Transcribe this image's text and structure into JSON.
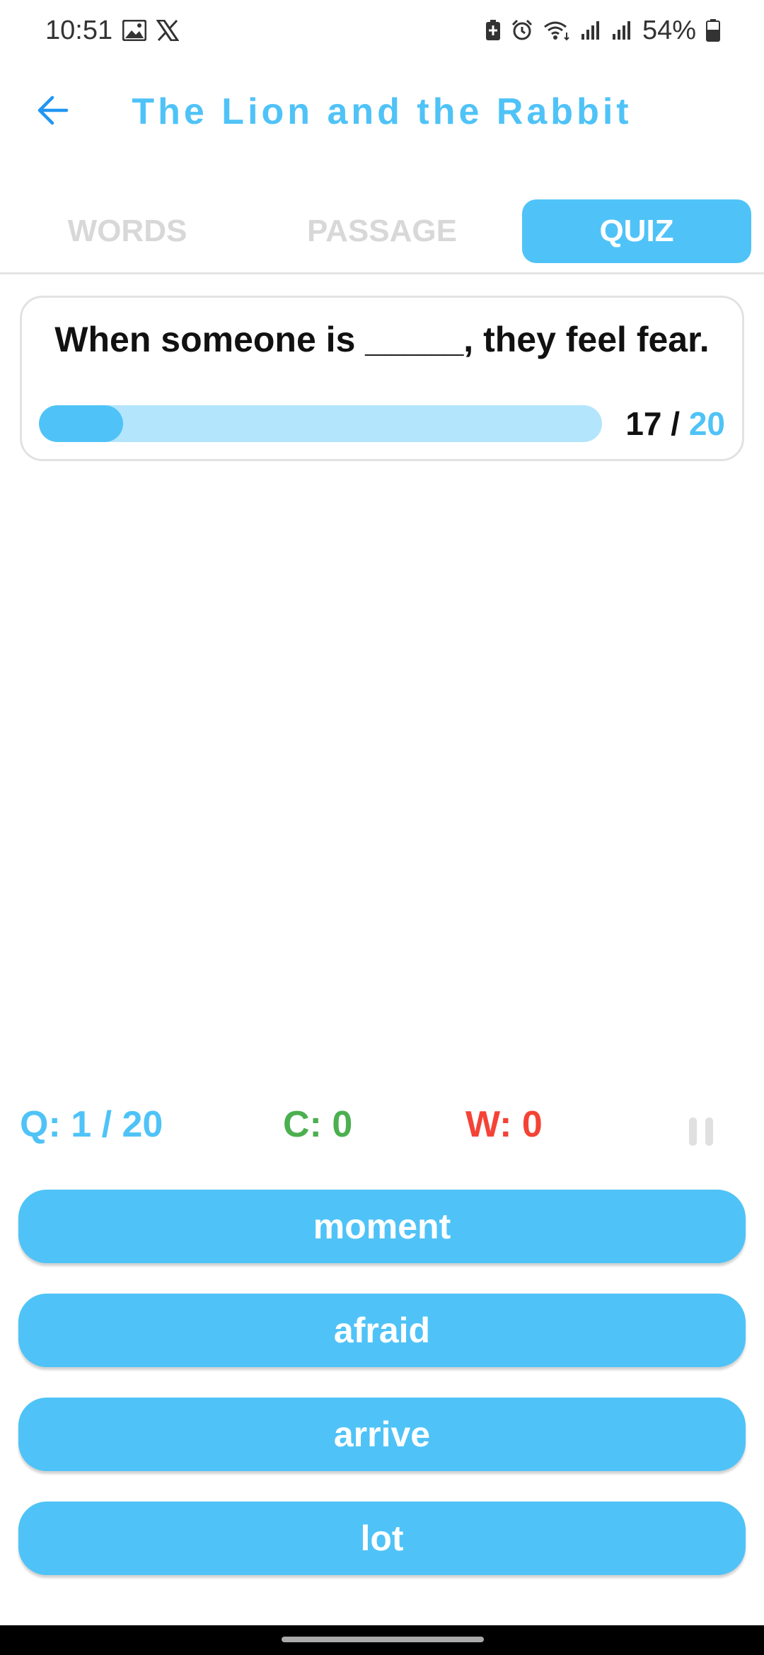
{
  "status_bar": {
    "time": "10:51",
    "left_icons": [
      "gallery-icon",
      "x-logo-icon"
    ],
    "right_icons": [
      "battery-saver-icon",
      "alarm-icon",
      "wifi-icon",
      "signal-icon",
      "signal-icon",
      "battery-icon"
    ],
    "battery_percent": "54%"
  },
  "app_bar": {
    "title": "The Lion and the Rabbit",
    "back_icon": "arrow-left-icon"
  },
  "tabs": [
    {
      "label": "WORDS",
      "active": false
    },
    {
      "label": "PASSAGE",
      "active": false
    },
    {
      "label": "QUIZ",
      "active": true
    }
  ],
  "question": {
    "text": "When someone is _____, they feel fear.",
    "timer_current": "17",
    "timer_separator": " / ",
    "timer_total": "20",
    "progress_fraction": 0.15
  },
  "score": {
    "question_progress": "Q: 1 / 20",
    "correct": "C: 0",
    "wrong": "W: 0",
    "pause_icon": "pause-icon"
  },
  "answers": [
    {
      "label": "moment"
    },
    {
      "label": "afraid"
    },
    {
      "label": "arrive"
    },
    {
      "label": "lot"
    }
  ],
  "colors": {
    "accent": "#4fc3f7",
    "accent_light": "#b3e5fc",
    "correct": "#4caf50",
    "wrong": "#f44336"
  }
}
